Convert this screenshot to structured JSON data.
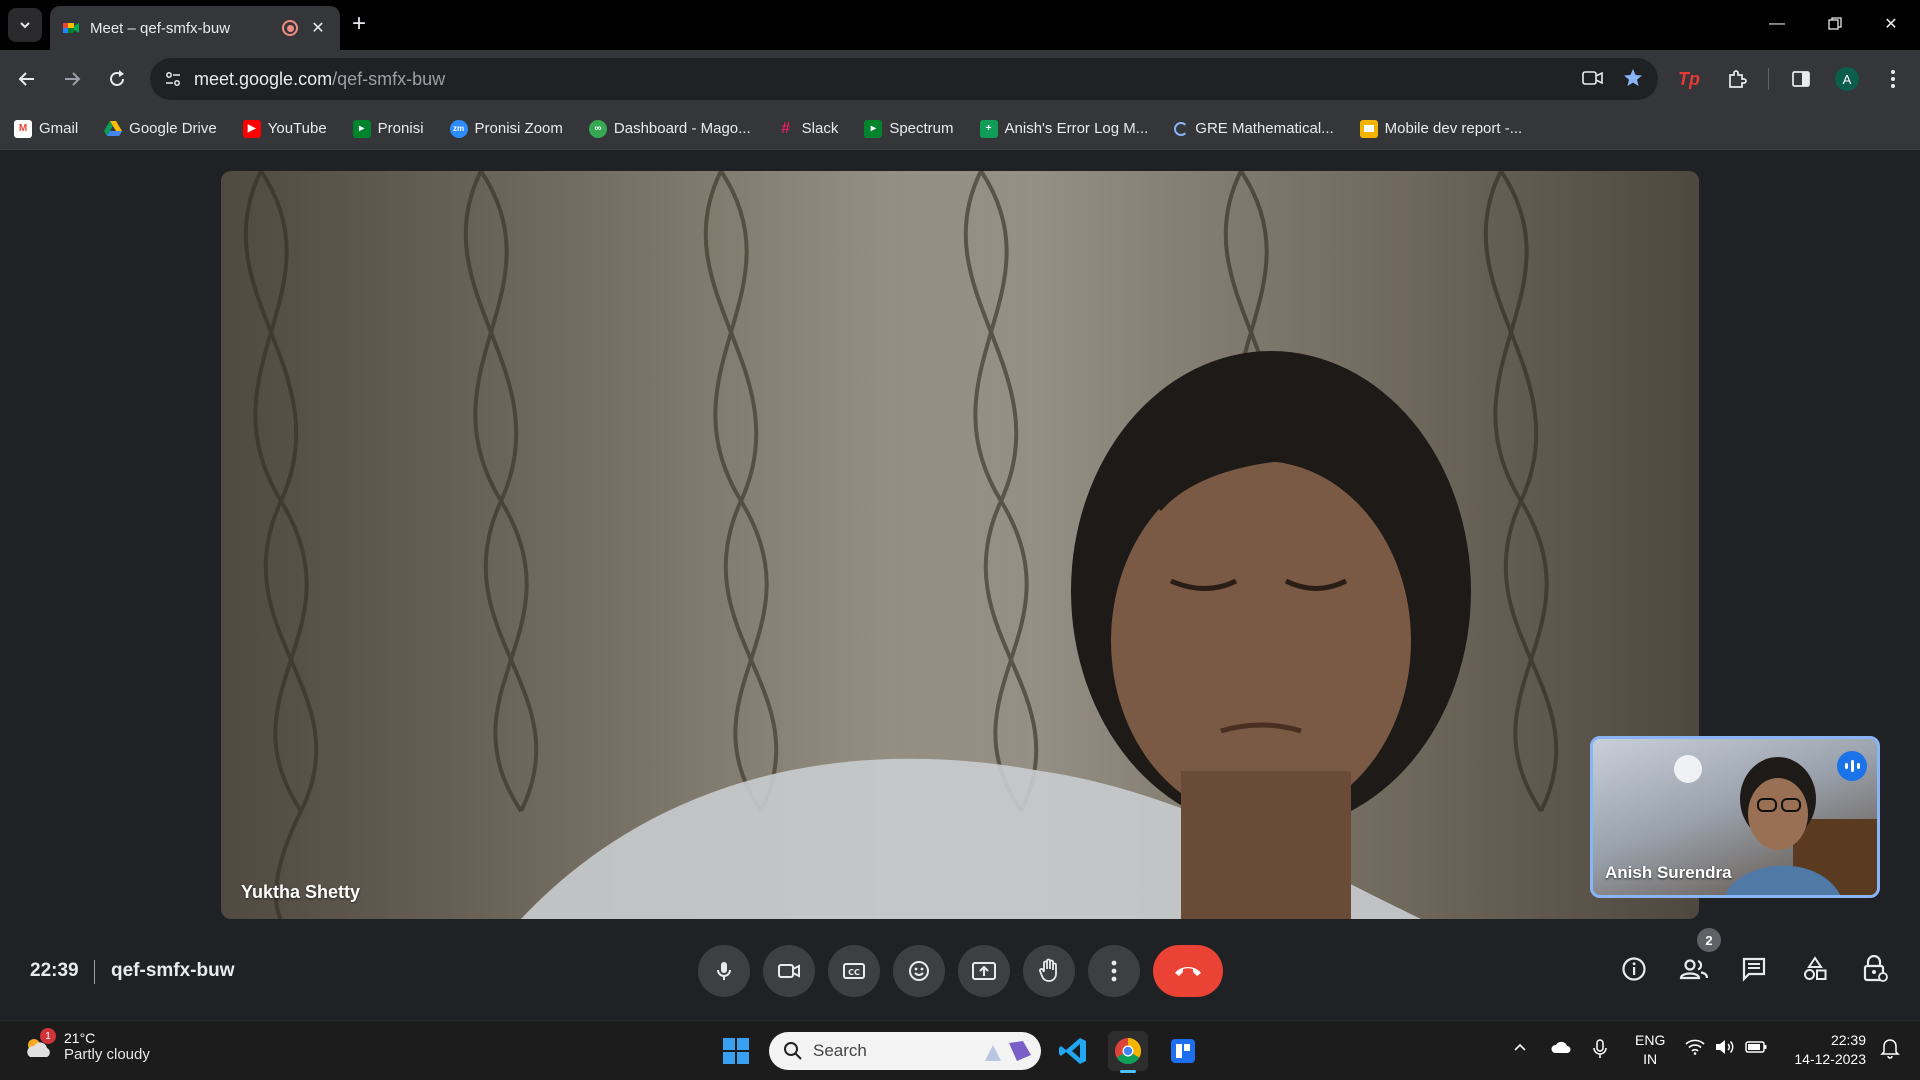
{
  "browser": {
    "tab_title": "Meet – qef-smfx-buw",
    "url_host": "meet.google.com",
    "url_path": "/qef-smfx-buw",
    "profile_initial": "A",
    "extension_label": "Tp"
  },
  "bookmarks": [
    {
      "label": "Gmail",
      "icon": "gmail-icon",
      "color": "#ea4335"
    },
    {
      "label": "Google Drive",
      "icon": "drive-icon",
      "color": "#fbbc04"
    },
    {
      "label": "YouTube",
      "icon": "youtube-icon",
      "color": "#ff0000"
    },
    {
      "label": "Pronisi",
      "icon": "meet-icon",
      "color": "#00832d"
    },
    {
      "label": "Pronisi Zoom",
      "icon": "zoom-icon",
      "color": "#2d8cff"
    },
    {
      "label": "Dashboard - Mago...",
      "icon": "dashboard-icon",
      "color": "#34a853"
    },
    {
      "label": "Slack",
      "icon": "slack-icon",
      "color": "#e01e5a"
    },
    {
      "label": "Spectrum",
      "icon": "meet-icon",
      "color": "#00832d"
    },
    {
      "label": "Anish's Error Log M...",
      "icon": "sheets-icon",
      "color": "#0f9d58"
    },
    {
      "label": "GRE Mathematical...",
      "icon": "loading-icon",
      "color": "#8ab4f8"
    },
    {
      "label": "Mobile dev report -...",
      "icon": "slides-icon",
      "color": "#f4b400"
    }
  ],
  "meet": {
    "main_participant": "Yuktha Shetty",
    "self_participant": "Anish Surendra",
    "time": "22:39",
    "meeting_code": "qef-smfx-buw",
    "participants_count": "2"
  },
  "taskbar": {
    "temperature": "21°C",
    "weather": "Partly cloudy",
    "weather_badge": "1",
    "search_placeholder": "Search",
    "lang_primary": "ENG",
    "lang_secondary": "IN",
    "clock_time": "22:39",
    "clock_date": "14-12-2023"
  }
}
